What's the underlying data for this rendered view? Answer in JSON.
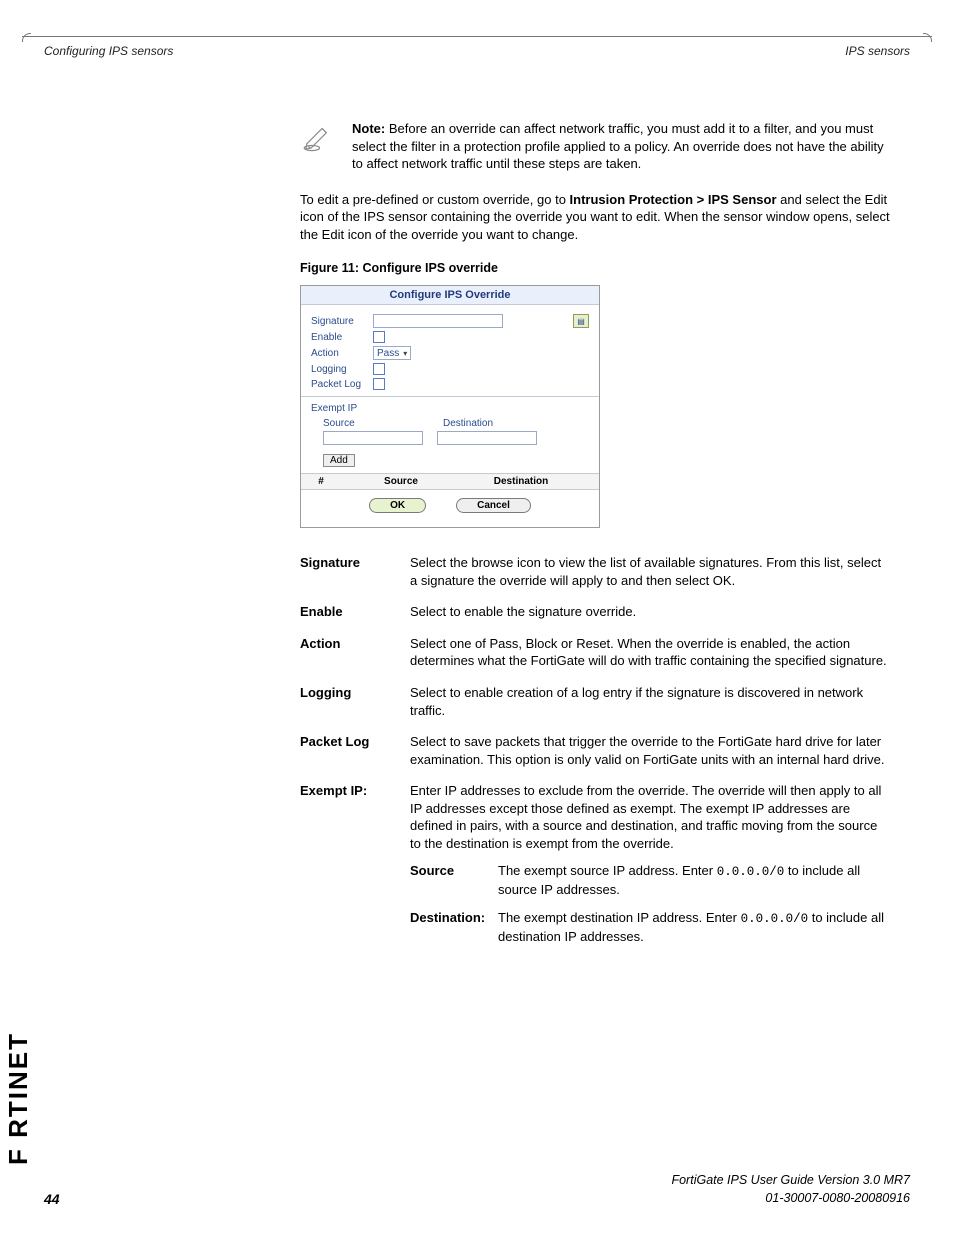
{
  "header": {
    "left": "Configuring IPS sensors",
    "right": "IPS sensors"
  },
  "note": {
    "label": "Note:",
    "text": "Before an override can affect network traffic, you must add it to a filter, and you must select the filter in a protection profile applied to a policy. An override does not have the ability to affect network traffic until these steps are taken."
  },
  "para": {
    "lead": "To edit a pre-defined or custom override, go to ",
    "bold_path": "Intrusion Protection > IPS Sensor",
    "tail": " and select the Edit icon of the IPS sensor containing the override you want to edit. When the sensor window opens, select the Edit icon of the override you want to change."
  },
  "figure_caption": "Figure 11: Configure IPS override",
  "shot": {
    "title": "Configure IPS Override",
    "rows": {
      "signature": "Signature",
      "enable": "Enable",
      "action": "Action",
      "action_value": "Pass",
      "logging": "Logging",
      "packetlog": "Packet Log"
    },
    "exempt": {
      "header": "Exempt IP",
      "source": "Source",
      "destination": "Destination",
      "add": "Add"
    },
    "thead": {
      "c1": "#",
      "c2": "Source",
      "c3": "Destination"
    },
    "buttons": {
      "ok": "OK",
      "cancel": "Cancel"
    }
  },
  "defs": [
    {
      "term": "Signature",
      "desc": "Select the browse icon to view the list of available signatures. From this list, select a signature the override will apply to and then select OK."
    },
    {
      "term": "Enable",
      "desc": "Select to enable the signature override."
    },
    {
      "term": "Action",
      "desc": "Select one of Pass, Block or Reset. When the override is enabled, the action determines what the FortiGate will do with traffic containing the specified signature."
    },
    {
      "term": "Logging",
      "desc": "Select to enable creation of a log entry if the signature is discovered in network traffic."
    },
    {
      "term": "Packet Log",
      "desc": "Select to save packets that trigger the override to the FortiGate hard drive for later examination. This option is only valid on FortiGate units with an internal hard drive."
    }
  ],
  "exempt_def": {
    "term": "Exempt IP:",
    "desc": "Enter IP addresses to exclude from the override. The override will then apply to all IP addresses except those defined as exempt. The exempt IP addresses are defined in pairs, with a source and destination, and traffic moving from the source to the destination is exempt from the override.",
    "sub": [
      {
        "term": "Source",
        "pre": "The exempt source IP address. Enter ",
        "code": "0.0.0.0/0",
        "post": " to include all source IP addresses."
      },
      {
        "term": "Destination:",
        "pre": "The exempt destination IP address. Enter ",
        "code": "0.0.0.0/0",
        "post": " to include all destination IP addresses."
      }
    ]
  },
  "footer": {
    "line1": "FortiGate IPS User Guide Version 3.0 MR7",
    "line2": "01-30007-0080-20080916",
    "page": "44"
  },
  "logo_text": "F   RTINET"
}
